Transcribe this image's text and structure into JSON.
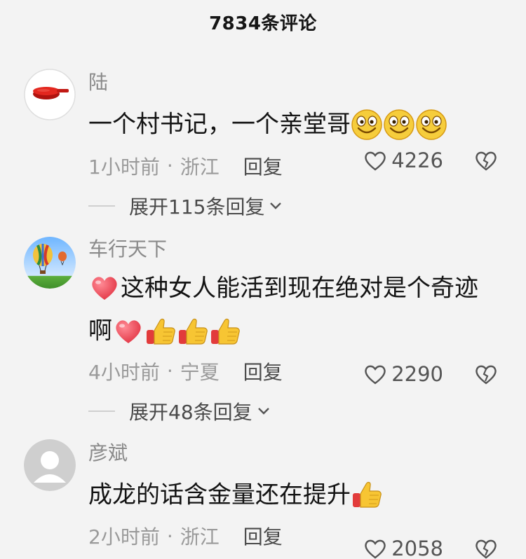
{
  "header": {
    "title": "7834条评论"
  },
  "comments": [
    {
      "username": "陆",
      "text": "一个村书记，一个亲堂哥",
      "time": "1小时前",
      "location": "浙江",
      "reply_label": "回复",
      "likes": "4226",
      "expand_label": "展开115条回复",
      "avatar_icon": "red-pan-avatar",
      "emojis": [
        "grin-face-emoji",
        "grin-face-emoji",
        "grin-face-emoji"
      ]
    },
    {
      "username": "车行天下",
      "text_part1": "这种女人能活到现在绝对是个奇迹",
      "text_part2": "啊",
      "time": "4小时前",
      "location": "宁夏",
      "reply_label": "回复",
      "likes": "2290",
      "expand_label": "展开48条回复",
      "avatar_icon": "hot-air-balloon-avatar",
      "emojis": [
        "heart-emoji",
        "heart-emoji",
        "thumbs-up-emoji",
        "thumbs-up-emoji",
        "thumbs-up-emoji"
      ]
    },
    {
      "username": "彦斌",
      "text": "成龙的话含金量还在提升",
      "time": "2小时前",
      "location": "浙江",
      "reply_label": "回复",
      "likes": "2058",
      "avatar_icon": "default-user-avatar",
      "emojis": [
        "thumbs-up-emoji"
      ]
    }
  ],
  "separator": "·",
  "colors": {
    "background": "#f3f3f3",
    "username": "#8a8a8a",
    "meta": "#9a9a9a",
    "text": "#141414"
  }
}
